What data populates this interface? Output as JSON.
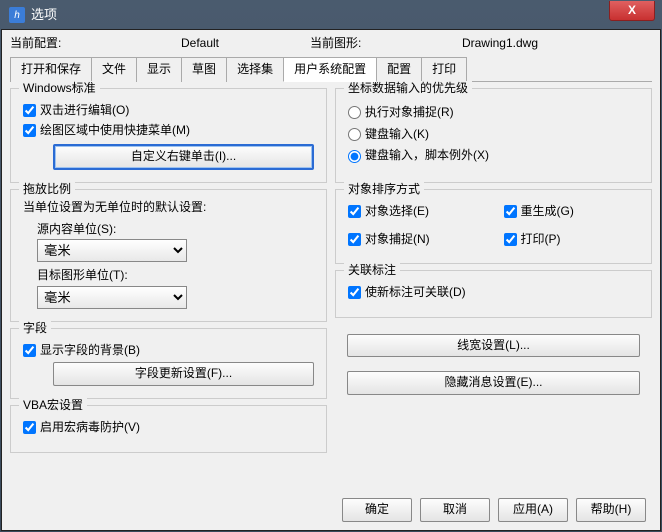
{
  "title": "选项",
  "close_icon": "X",
  "header": {
    "cur_config_label": "当前配置:",
    "cur_config_value": "Default",
    "cur_drawing_label": "当前图形:",
    "cur_drawing_value": "Drawing1.dwg"
  },
  "tabs": [
    "打开和保存",
    "文件",
    "显示",
    "草图",
    "选择集",
    "用户系统配置",
    "配置",
    "打印"
  ],
  "active_tab": "用户系统配置",
  "left": {
    "windows_standard": {
      "title": "Windows标准",
      "dblclick_edit": "双击进行编辑(O)",
      "context_menu": "绘图区域中使用快捷菜单(M)",
      "custom_rclick_btn": "自定义右键单击(I)..."
    },
    "dragscale": {
      "title": "拖放比例",
      "desc": "当单位设置为无单位时的默认设置:",
      "src_label": "源内容单位(S):",
      "tgt_label": "目标图形单位(T):",
      "unit_value": "毫米"
    },
    "field": {
      "title": "字段",
      "show_bg": "显示字段的背景(B)",
      "update_btn": "字段更新设置(F)..."
    },
    "vba": {
      "title": "VBA宏设置",
      "enable_macro": "启用宏病毒防护(V)"
    }
  },
  "right": {
    "priority": {
      "title": "坐标数据输入的优先级",
      "exec_obj": "执行对象捕捉(R)",
      "keyboard": "键盘输入(K)",
      "keyboard_except": "键盘输入，脚本例外(X)"
    },
    "sort": {
      "title": "对象排序方式",
      "obj_select": "对象选择(E)",
      "regen": "重生成(G)",
      "obj_snap": "对象捕捉(N)",
      "print": "打印(P)"
    },
    "assoc": {
      "title": "关联标注",
      "make_assoc": "使新标注可关联(D)"
    },
    "lineweight_btn": "线宽设置(L)...",
    "hidemsg_btn": "隐藏消息设置(E)..."
  },
  "footer": {
    "ok": "确定",
    "cancel": "取消",
    "apply": "应用(A)",
    "help": "帮助(H)"
  }
}
